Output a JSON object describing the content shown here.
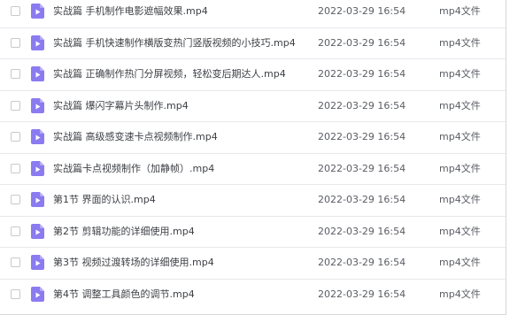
{
  "file_icon": "video-file-icon",
  "icon_color": "#8b7bf0",
  "files": [
    {
      "name": "实战篇 手机制作电影遮幅效果.mp4",
      "date": "2022-03-29 16:54",
      "type": "mp4文件"
    },
    {
      "name": "实战篇 手机快速制作横版变热门竖版视频的小技巧.mp4",
      "date": "2022-03-29 16:54",
      "type": "mp4文件"
    },
    {
      "name": "实战篇 正确制作热门分屏视频，轻松变后期达人.mp4",
      "date": "2022-03-29 16:54",
      "type": "mp4文件"
    },
    {
      "name": "实战篇 爆闪字幕片头制作.mp4",
      "date": "2022-03-29 16:54",
      "type": "mp4文件"
    },
    {
      "name": "实战篇 高级感变速卡点视频制作.mp4",
      "date": "2022-03-29 16:54",
      "type": "mp4文件"
    },
    {
      "name": "实战篇卡点视频制作（加静帧）.mp4",
      "date": "2022-03-29 16:54",
      "type": "mp4文件"
    },
    {
      "name": "第1节 界面的认识.mp4",
      "date": "2022-03-29 16:54",
      "type": "mp4文件"
    },
    {
      "name": "第2节 剪辑功能的详细使用.mp4",
      "date": "2022-03-29 16:54",
      "type": "mp4文件"
    },
    {
      "name": "第3节 视频过渡转场的详细使用.mp4",
      "date": "2022-03-29 16:54",
      "type": "mp4文件"
    },
    {
      "name": "第4节 调整工具颜色的调节.mp4",
      "date": "2022-03-29 16:54",
      "type": "mp4文件"
    }
  ]
}
